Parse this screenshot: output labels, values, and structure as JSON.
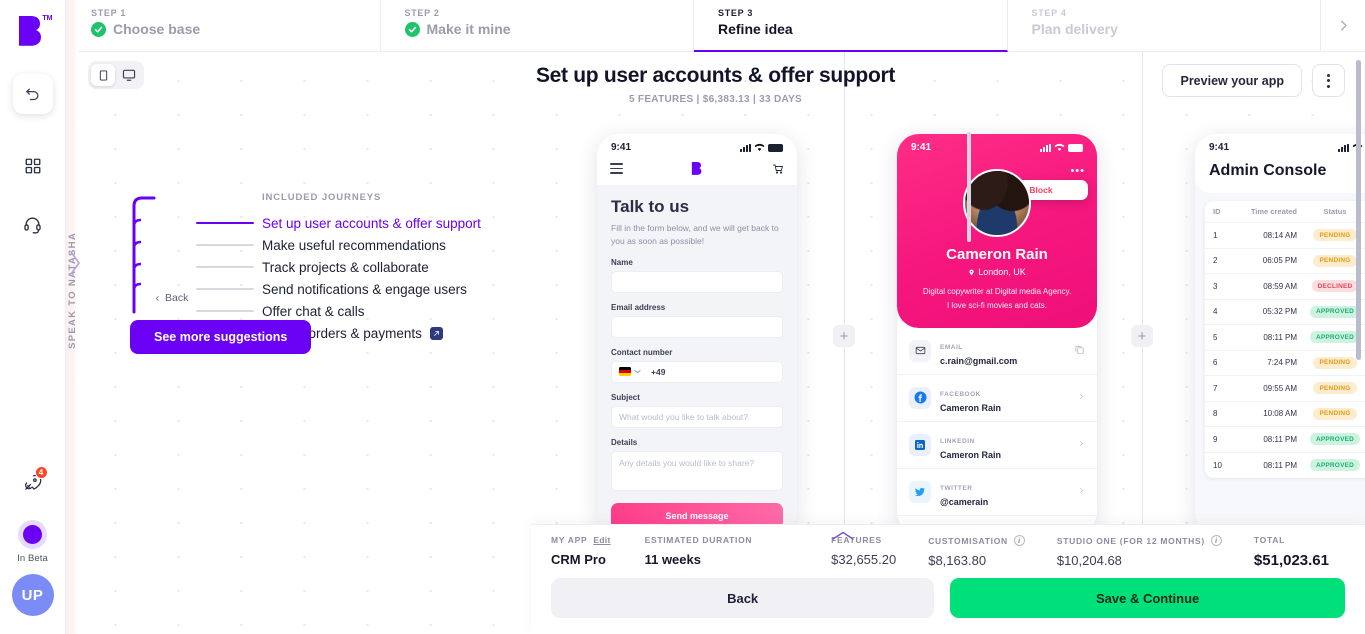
{
  "brand": {
    "logo_tm": "TM",
    "accent": "#6a00f4",
    "green": "#00e07a",
    "pink": "#ff2d86"
  },
  "rail": {
    "undo_icon": "undo-icon",
    "grid_icon": "grid-icon",
    "support_icon": "headset-icon",
    "rocket_icon": "rocket-icon",
    "rocket_badge": "4",
    "beta_label": "In Beta",
    "avatar_initials": "UP"
  },
  "steps": [
    {
      "label": "STEP 1",
      "title": "Choose base",
      "state": "done"
    },
    {
      "label": "STEP 2",
      "title": "Make it mine",
      "state": "done"
    },
    {
      "label": "STEP 3",
      "title": "Refine idea",
      "state": "active"
    },
    {
      "label": "STEP 4",
      "title": "Plan delivery",
      "state": "disabled"
    }
  ],
  "header": {
    "title": "Set up user accounts & offer support",
    "subtitle": "5 FEATURES | $6,383.13 | 33 DAYS",
    "preview_label": "Preview your app",
    "view_mobile": "mobile-icon",
    "view_desktop": "desktop-icon"
  },
  "canvas": {
    "natasha_label": "SPEAK TO NATASHA",
    "journeys_heading": "INCLUDED JOURNEYS",
    "journeys": [
      {
        "label": "Set up user accounts & offer support",
        "selected": true,
        "editable": false
      },
      {
        "label": "Make useful recommendations",
        "selected": false,
        "editable": false
      },
      {
        "label": "Track projects & collaborate",
        "selected": false,
        "editable": false
      },
      {
        "label": "Send notifications & engage users",
        "selected": false,
        "editable": false
      },
      {
        "label": "Offer chat & calls",
        "selected": false,
        "editable": false
      },
      {
        "label": "Handle orders & payments",
        "selected": false,
        "editable": true
      }
    ],
    "back_label": "Back",
    "suggestions_label": "See more suggestions",
    "add_screen_label": "+"
  },
  "screens": {
    "phone1": {
      "status_time": "9:41",
      "heading": "Talk to us",
      "intro": "Fill in the form below, and we will get back to you as soon as possible!",
      "fields": [
        {
          "label": "Name",
          "value": "",
          "placeholder": ""
        },
        {
          "label": "Email address",
          "value": "",
          "placeholder": ""
        },
        {
          "label": "Contact number",
          "value": "+49",
          "placeholder": ""
        },
        {
          "label": "Subject",
          "value": "",
          "placeholder": "What would you like to talk about?"
        },
        {
          "label": "Details",
          "value": "",
          "placeholder": "Any details you would like to share?"
        }
      ],
      "submit_label": "Send message",
      "menu_icon": "hamburger-icon",
      "cart_icon": "cart-icon"
    },
    "phone2": {
      "status_time": "9:41",
      "menu_block_label": "Block",
      "name": "Cameron Rain",
      "location": "London, UK",
      "bio_line1": "Digital copywriter at Digital media Agency.",
      "bio_line2": "I love sci-fi movies and cats.",
      "contacts": [
        {
          "label": "EMAIL",
          "value": "c.rain@gmail.com",
          "icon": "mail-icon",
          "action": "copy-icon"
        },
        {
          "label": "FACEBOOK",
          "value": "Cameron Rain",
          "icon": "facebook-icon",
          "action": "chevron-right-icon"
        },
        {
          "label": "LINKEDIN",
          "value": "Cameron Rain",
          "icon": "linkedin-icon",
          "action": "chevron-right-icon"
        },
        {
          "label": "TWITTER",
          "value": "@camerain",
          "icon": "twitter-icon",
          "action": "chevron-right-icon"
        }
      ]
    },
    "phone3": {
      "status_time": "9:41",
      "title": "Admin Console",
      "columns": [
        "ID",
        "Time created",
        "Status"
      ],
      "rows": [
        {
          "id": "1",
          "time": "08:14 AM",
          "status": "PENDING"
        },
        {
          "id": "2",
          "time": "06:05 PM",
          "status": "PENDING"
        },
        {
          "id": "3",
          "time": "08:59 AM",
          "status": "DECLINED"
        },
        {
          "id": "4",
          "time": "05:32 PM",
          "status": "APPROVED"
        },
        {
          "id": "5",
          "time": "08:11 PM",
          "status": "APPROVED"
        },
        {
          "id": "6",
          "time": "7:24 PM",
          "status": "PENDING"
        },
        {
          "id": "7",
          "time": "09:55 AM",
          "status": "PENDING"
        },
        {
          "id": "8",
          "time": "10:08 AM",
          "status": "PENDING"
        },
        {
          "id": "9",
          "time": "08:11 PM",
          "status": "APPROVED"
        },
        {
          "id": "10",
          "time": "08:11 PM",
          "status": "APPROVED"
        }
      ]
    }
  },
  "summary": {
    "app_label": "MY APP",
    "app_edit": "Edit",
    "app_name": "CRM Pro",
    "duration_label": "ESTIMATED DURATION",
    "duration_value": "11 weeks",
    "costs": [
      {
        "label": "FEATURES",
        "value": "$32,655.20",
        "info": false
      },
      {
        "label": "CUSTOMISATION",
        "value": "$8,163.80",
        "info": true
      },
      {
        "label": "STUDIO ONE (FOR 12 MONTHS)",
        "value": "$10,204.68",
        "info": true
      }
    ],
    "total_label": "TOTAL",
    "total_value": "$51,023.61",
    "back_label": "Back",
    "save_label": "Save & Continue"
  }
}
